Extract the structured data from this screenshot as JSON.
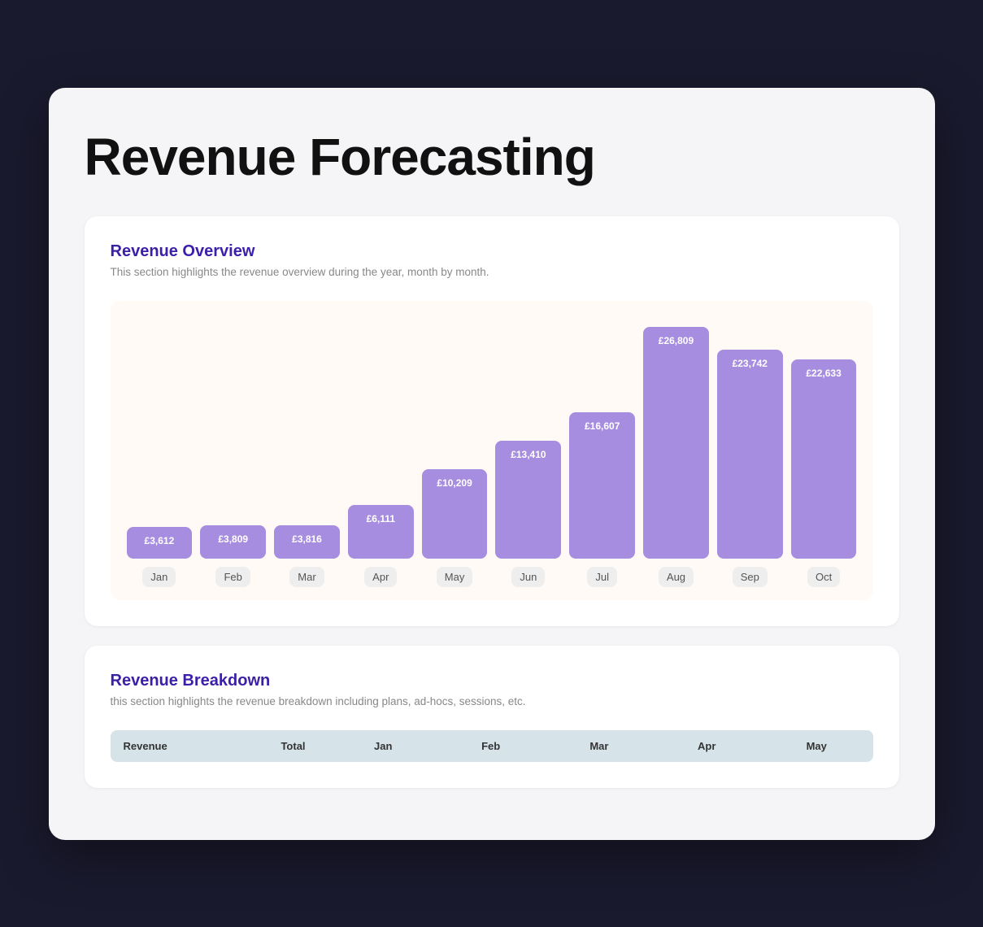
{
  "page": {
    "title": "Revenue Forecasting",
    "background": "#f5f5f7"
  },
  "overview": {
    "section_title": "Revenue Overview",
    "section_desc": "This section highlights the revenue overview during the year, month by month.",
    "chart": {
      "max_value": 26809,
      "bars": [
        {
          "month": "Jan",
          "value": 3612,
          "label": "£3,612"
        },
        {
          "month": "Feb",
          "value": 3809,
          "label": "£3,809"
        },
        {
          "month": "Mar",
          "value": 3816,
          "label": "£3,816"
        },
        {
          "month": "Apr",
          "value": 6111,
          "label": "£6,111"
        },
        {
          "month": "May",
          "value": 10209,
          "label": "£10,209"
        },
        {
          "month": "Jun",
          "value": 13410,
          "label": "£13,410"
        },
        {
          "month": "Jul",
          "value": 16607,
          "label": "£16,607"
        },
        {
          "month": "Aug",
          "value": 26809,
          "label": "£26,809"
        },
        {
          "month": "Sep",
          "value": 23742,
          "label": "£23,742"
        },
        {
          "month": "Oct",
          "value": 22633,
          "label": "£22,633"
        }
      ]
    }
  },
  "breakdown": {
    "section_title": "Revenue Breakdown",
    "section_desc": "this section highlights the revenue breakdown including plans, ad-hocs, sessions, etc.",
    "table": {
      "headers": [
        "Revenue",
        "Total",
        "Jan",
        "Feb",
        "Mar",
        "Apr",
        "May"
      ]
    }
  }
}
